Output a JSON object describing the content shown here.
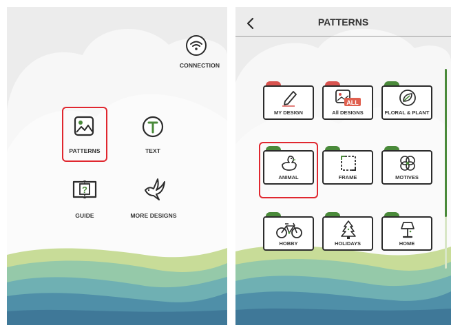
{
  "left_screen": {
    "connection": {
      "label": "CONNECTION",
      "icon": "wifi-icon"
    },
    "menu": [
      {
        "id": "patterns",
        "label": "PATTERNS",
        "icon": "image-icon",
        "selected": true
      },
      {
        "id": "text",
        "label": "TEXT",
        "icon": "text-t-icon",
        "selected": false
      },
      {
        "id": "guide",
        "label": "GUIDE",
        "icon": "book-question-icon",
        "selected": false
      },
      {
        "id": "more-designs",
        "label": "MORE DESIGNS",
        "icon": "bird-icon",
        "selected": false
      }
    ]
  },
  "right_screen": {
    "header": {
      "title": "PATTERNS",
      "back_icon": "chevron-left-icon"
    },
    "categories": [
      {
        "label": "MY DESIGN",
        "icon": "pencil-icon",
        "tab_color": "#d9534f"
      },
      {
        "label": "All DESIGNS",
        "icon": "image-all-icon",
        "badge": "ALL",
        "tab_color": "#d9534f"
      },
      {
        "label": "FLORAL & PLANT",
        "icon": "leaf-icon",
        "tab_color": "#4a8a3a"
      },
      {
        "label": "ANIMAL",
        "icon": "duck-icon",
        "tab_color": "#4a8a3a",
        "selected": true
      },
      {
        "label": "FRAME",
        "icon": "frame-icon",
        "tab_color": "#4a8a3a"
      },
      {
        "label": "MOTIVES",
        "icon": "flower-icon",
        "tab_color": "#4a8a3a"
      },
      {
        "label": "HOBBY",
        "icon": "bicycle-icon",
        "tab_color": "#4a8a3a"
      },
      {
        "label": "HOLIDAYS",
        "icon": "tree-icon",
        "tab_color": "#4a8a3a"
      },
      {
        "label": "HOME",
        "icon": "lamp-icon",
        "tab_color": "#4a8a3a"
      }
    ]
  },
  "colors": {
    "accent_green": "#4a8a3a",
    "selection_red": "#e0272f",
    "tab_red": "#d9534f"
  }
}
